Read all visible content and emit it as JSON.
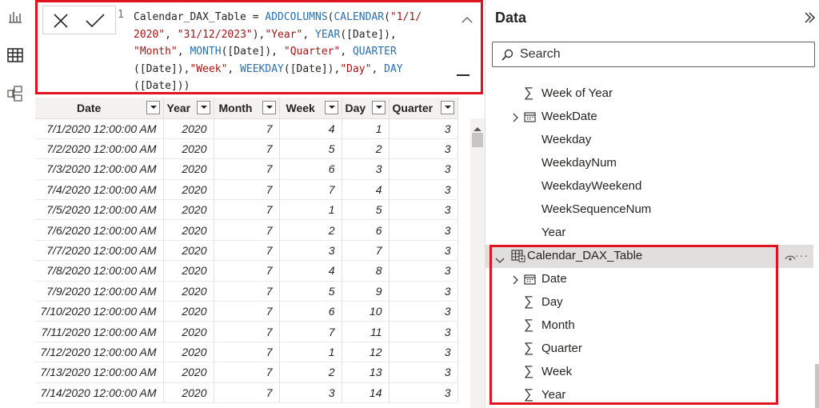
{
  "formula": {
    "line_number": "1",
    "line1": [
      "Calendar_DAX_Table = ",
      "ADDCOLUMNS",
      "(",
      "CALENDAR",
      "(",
      "\"1/1/"
    ],
    "line2": [
      "2020\"",
      ", ",
      "\"31/12/2023\"",
      "),",
      "\"Year\"",
      ", ",
      "YEAR",
      "([Date]),"
    ],
    "line3": [
      "\"Month\"",
      ", ",
      "MONTH",
      "([Date]), ",
      "\"Quarter\"",
      ", ",
      "QUARTER"
    ],
    "line4": [
      "([Date]),",
      "\"Week\"",
      ", ",
      "WEEKDAY",
      "([Date]),",
      "\"Day\"",
      ", ",
      "DAY"
    ],
    "line5": [
      "([Date]))"
    ]
  },
  "table": {
    "columns": [
      "Date",
      "Year",
      "Month",
      "Week",
      "Day",
      "Quarter"
    ],
    "rows": [
      [
        "7/1/2020 12:00:00 AM",
        "2020",
        "7",
        "4",
        "1",
        "3"
      ],
      [
        "7/2/2020 12:00:00 AM",
        "2020",
        "7",
        "5",
        "2",
        "3"
      ],
      [
        "7/3/2020 12:00:00 AM",
        "2020",
        "7",
        "6",
        "3",
        "3"
      ],
      [
        "7/4/2020 12:00:00 AM",
        "2020",
        "7",
        "7",
        "4",
        "3"
      ],
      [
        "7/5/2020 12:00:00 AM",
        "2020",
        "7",
        "1",
        "5",
        "3"
      ],
      [
        "7/6/2020 12:00:00 AM",
        "2020",
        "7",
        "2",
        "6",
        "3"
      ],
      [
        "7/7/2020 12:00:00 AM",
        "2020",
        "7",
        "3",
        "7",
        "3"
      ],
      [
        "7/8/2020 12:00:00 AM",
        "2020",
        "7",
        "4",
        "8",
        "3"
      ],
      [
        "7/9/2020 12:00:00 AM",
        "2020",
        "7",
        "5",
        "9",
        "3"
      ],
      [
        "7/10/2020 12:00:00 AM",
        "2020",
        "7",
        "6",
        "10",
        "3"
      ],
      [
        "7/11/2020 12:00:00 AM",
        "2020",
        "7",
        "7",
        "11",
        "3"
      ],
      [
        "7/12/2020 12:00:00 AM",
        "2020",
        "7",
        "1",
        "12",
        "3"
      ],
      [
        "7/13/2020 12:00:00 AM",
        "2020",
        "7",
        "2",
        "13",
        "3"
      ],
      [
        "7/14/2020 12:00:00 AM",
        "2020",
        "7",
        "3",
        "14",
        "3"
      ]
    ]
  },
  "pane": {
    "title": "Data",
    "search_placeholder": "Search",
    "items": [
      {
        "label": "Week of Year",
        "icon": "sigma-icon",
        "level": 1
      },
      {
        "label": "WeekDate",
        "icon": "calendar-icon",
        "level": 1,
        "expandable": true
      },
      {
        "label": "Weekday",
        "icon": "",
        "level": 1
      },
      {
        "label": "WeekdayNum",
        "icon": "",
        "level": 1
      },
      {
        "label": "WeekdayWeekend",
        "icon": "",
        "level": 1
      },
      {
        "label": "WeekSequenceNum",
        "icon": "",
        "level": 1
      },
      {
        "label": "Year",
        "icon": "",
        "level": 1
      },
      {
        "label": "Calendar_DAX_Table",
        "icon": "calculated-table-icon",
        "level": 0,
        "expanded": true,
        "selected": true
      },
      {
        "label": "Date",
        "icon": "calendar-icon",
        "level": 1,
        "expandable": true
      },
      {
        "label": "Day",
        "icon": "sigma-icon",
        "level": 1
      },
      {
        "label": "Month",
        "icon": "sigma-icon",
        "level": 1
      },
      {
        "label": "Quarter",
        "icon": "sigma-icon",
        "level": 1
      },
      {
        "label": "Week",
        "icon": "sigma-icon",
        "level": 1
      },
      {
        "label": "Year",
        "icon": "sigma-icon",
        "level": 1
      }
    ]
  },
  "colors": {
    "highlight": "#e0141e",
    "keyword": "#2a6fb0",
    "string": "#a31515"
  }
}
